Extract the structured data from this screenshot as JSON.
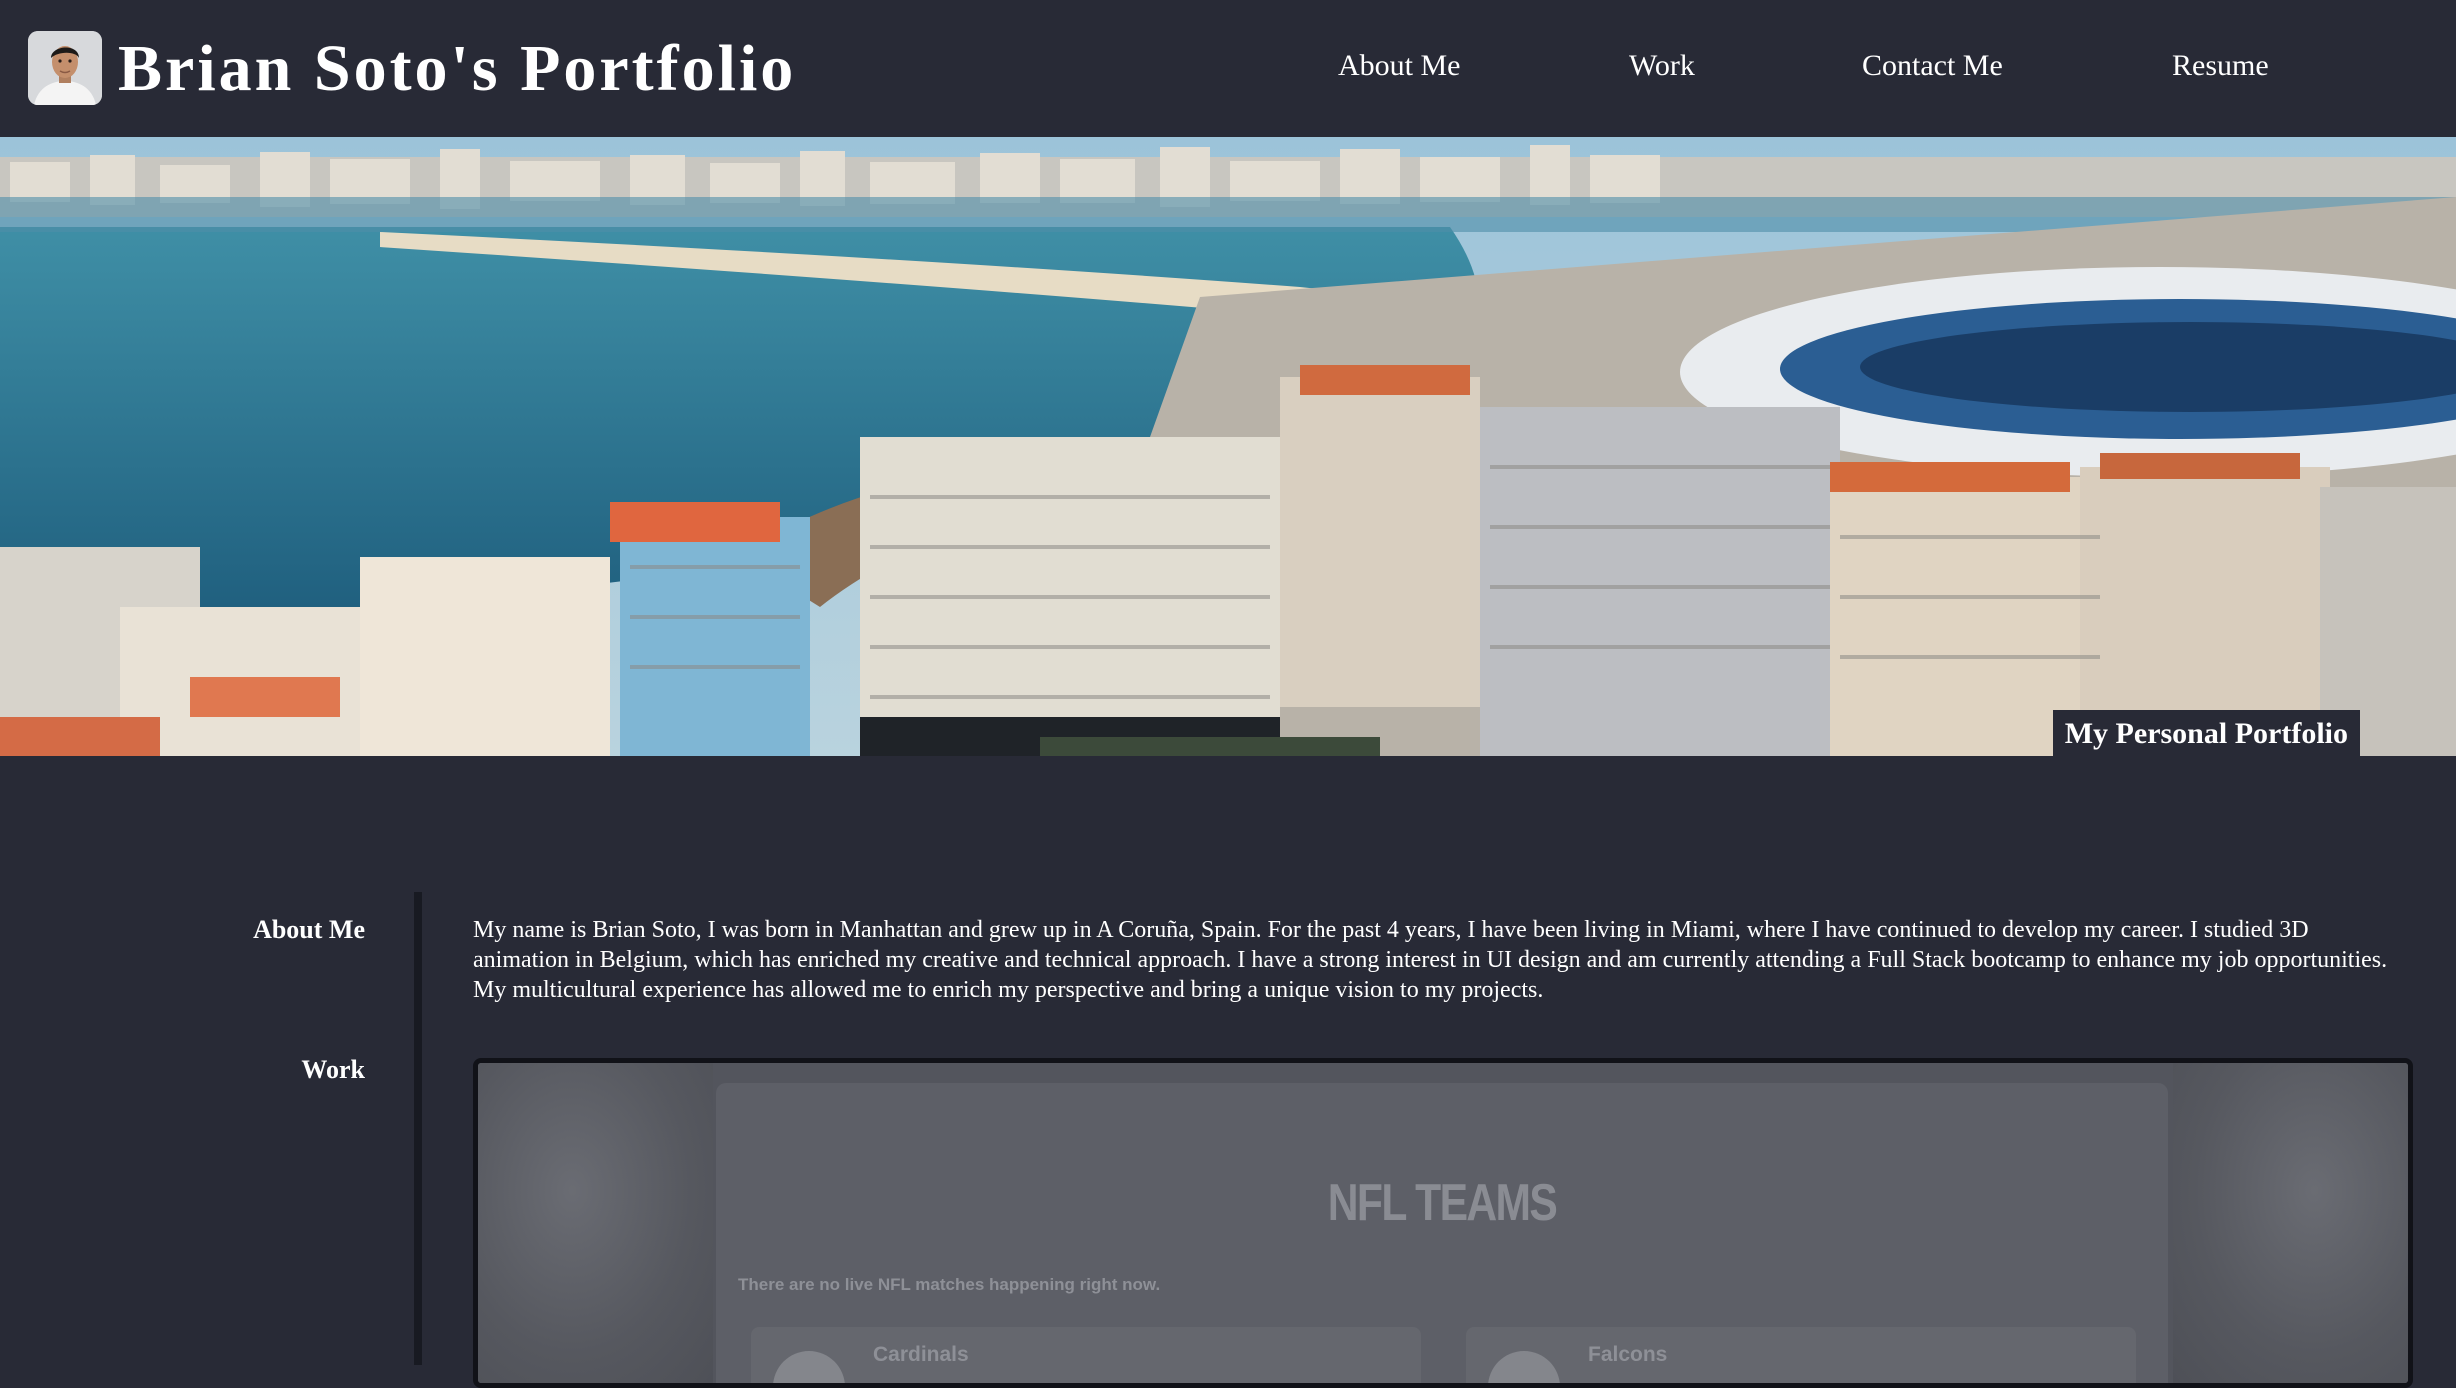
{
  "header": {
    "title": "Brian Soto's Portfolio",
    "nav": [
      "About Me",
      "Work",
      "Contact Me",
      "Resume"
    ]
  },
  "hero": {
    "caption": "My Personal Portfolio"
  },
  "side_nav": [
    "About Me",
    "Work"
  ],
  "about": {
    "text": "My name is Brian Soto, I was born in Manhattan and grew up in A Coruña, Spain. For the past 4 years, I have been living in Miami, where I have continued to develop my career. I studied 3D animation in Belgium, which has enriched my creative and technical approach. I have a strong interest in UI design and am currently attending a Full Stack bootcamp to enhance my job opportunities. My multicultural experience has allowed me to enrich my perspective and bring a unique vision to my projects."
  },
  "work_preview": {
    "title": "NFL TEAMS",
    "note": "There are no live NFL matches happening right now.",
    "teams": [
      "Cardinals",
      "Falcons"
    ]
  },
  "colors": {
    "background": "#282a36",
    "text": "#ffffff",
    "preview_bg": "#53555d"
  }
}
